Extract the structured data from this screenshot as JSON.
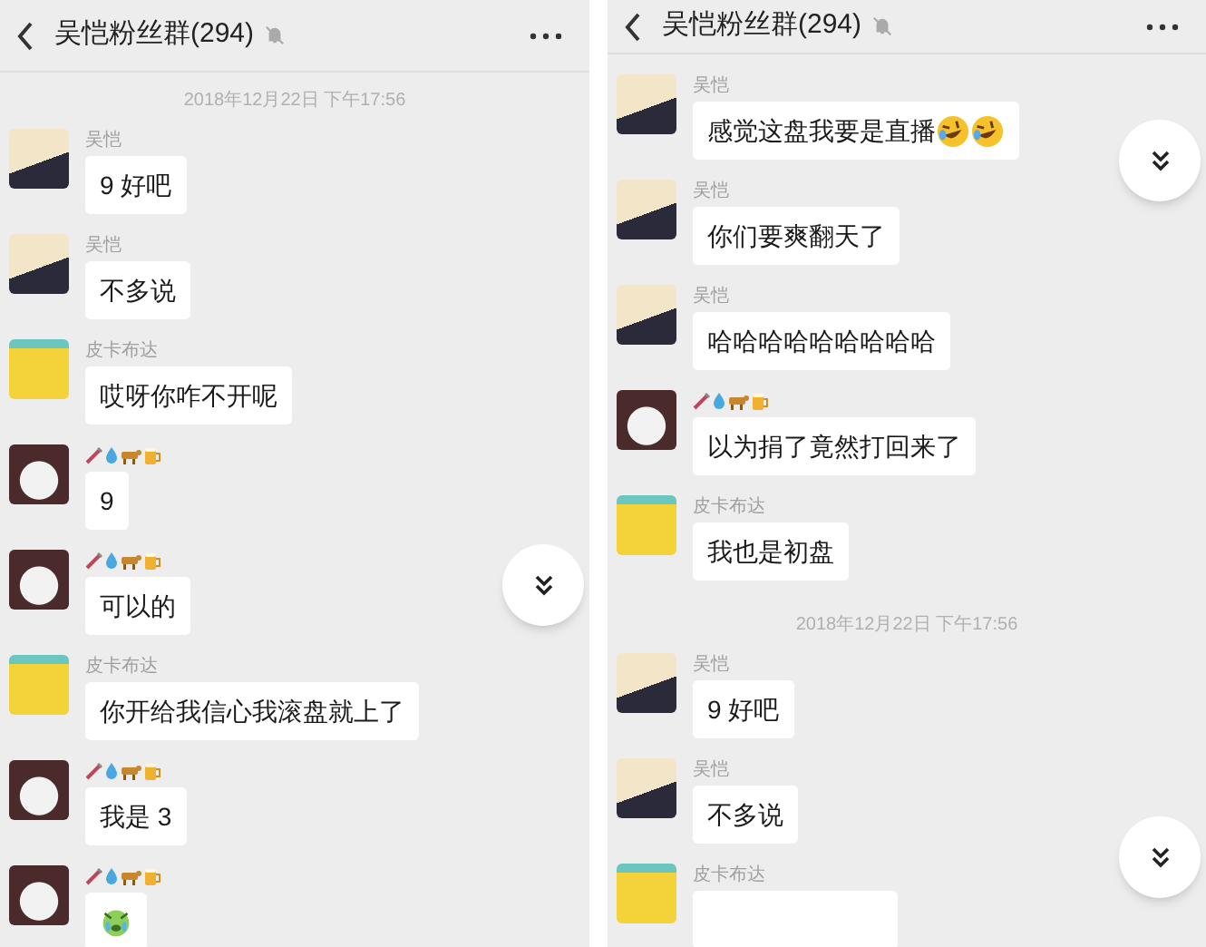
{
  "panels": [
    {
      "header": {
        "title": "吴恺粉丝群(294)",
        "muted": true
      },
      "items": [
        {
          "kind": "timestamp",
          "text": "2018年12月22日 下午17:56"
        },
        {
          "kind": "message",
          "avatar": {
            "kind": "girl"
          },
          "author": {
            "kind": "text",
            "name": "吴恺"
          },
          "text": "9 好吧"
        },
        {
          "kind": "message",
          "avatar": {
            "kind": "girl"
          },
          "author": {
            "kind": "text",
            "name": "吴恺"
          },
          "text": "不多说"
        },
        {
          "kind": "message",
          "avatar": {
            "kind": "pikachu"
          },
          "author": {
            "kind": "text",
            "name": "皮卡布达"
          },
          "text": "哎呀你咋不开呢"
        },
        {
          "kind": "message",
          "avatar": {
            "kind": "bear"
          },
          "author": {
            "kind": "emoji"
          },
          "text": "9"
        },
        {
          "kind": "message",
          "avatar": {
            "kind": "bear"
          },
          "author": {
            "kind": "emoji"
          },
          "text": "可以的"
        },
        {
          "kind": "message",
          "avatar": {
            "kind": "pikachu"
          },
          "author": {
            "kind": "text",
            "name": "皮卡布达"
          },
          "text": "你开给我信心我滚盘就上了"
        },
        {
          "kind": "message",
          "avatar": {
            "kind": "bear"
          },
          "author": {
            "kind": "emoji"
          },
          "text": "我是 3"
        },
        {
          "kind": "message",
          "avatar": {
            "kind": "bear"
          },
          "author": {
            "kind": "emoji"
          },
          "emojis": [
            {
              "kind": "crying"
            }
          ]
        }
      ],
      "scroll_buttons": [
        {
          "kind": "middle"
        }
      ]
    },
    {
      "header": {
        "title": "吴恺粉丝群(294)",
        "muted": true
      },
      "items": [
        {
          "kind": "message",
          "avatar": {
            "kind": "girl"
          },
          "author": {
            "kind": "text",
            "name": "吴恺"
          },
          "text": "感觉这盘我要是直播",
          "emojis": [
            {
              "kind": "laugh"
            },
            {
              "kind": "laugh"
            }
          ]
        },
        {
          "kind": "message",
          "avatar": {
            "kind": "girl"
          },
          "author": {
            "kind": "text",
            "name": "吴恺"
          },
          "text": "你们要爽翻天了"
        },
        {
          "kind": "message",
          "avatar": {
            "kind": "girl"
          },
          "author": {
            "kind": "text",
            "name": "吴恺"
          },
          "text": "哈哈哈哈哈哈哈哈哈"
        },
        {
          "kind": "message",
          "avatar": {
            "kind": "bear"
          },
          "author": {
            "kind": "emoji"
          },
          "text": "以为捐了竟然打回来了"
        },
        {
          "kind": "message",
          "avatar": {
            "kind": "pikachu"
          },
          "author": {
            "kind": "text",
            "name": "皮卡布达"
          },
          "text": "我也是初盘"
        },
        {
          "kind": "timestamp",
          "text": "2018年12月22日 下午17:56"
        },
        {
          "kind": "message",
          "avatar": {
            "kind": "girl"
          },
          "author": {
            "kind": "text",
            "name": "吴恺"
          },
          "text": "9 好吧"
        },
        {
          "kind": "message",
          "avatar": {
            "kind": "girl"
          },
          "author": {
            "kind": "text",
            "name": "吴恺"
          },
          "text": "不多说"
        },
        {
          "kind": "message",
          "avatar": {
            "kind": "pikachu"
          },
          "author": {
            "kind": "text",
            "name": "皮卡布达"
          }
        }
      ],
      "scroll_buttons": [
        {
          "kind": "top"
        },
        {
          "kind": "bottom"
        }
      ]
    }
  ]
}
